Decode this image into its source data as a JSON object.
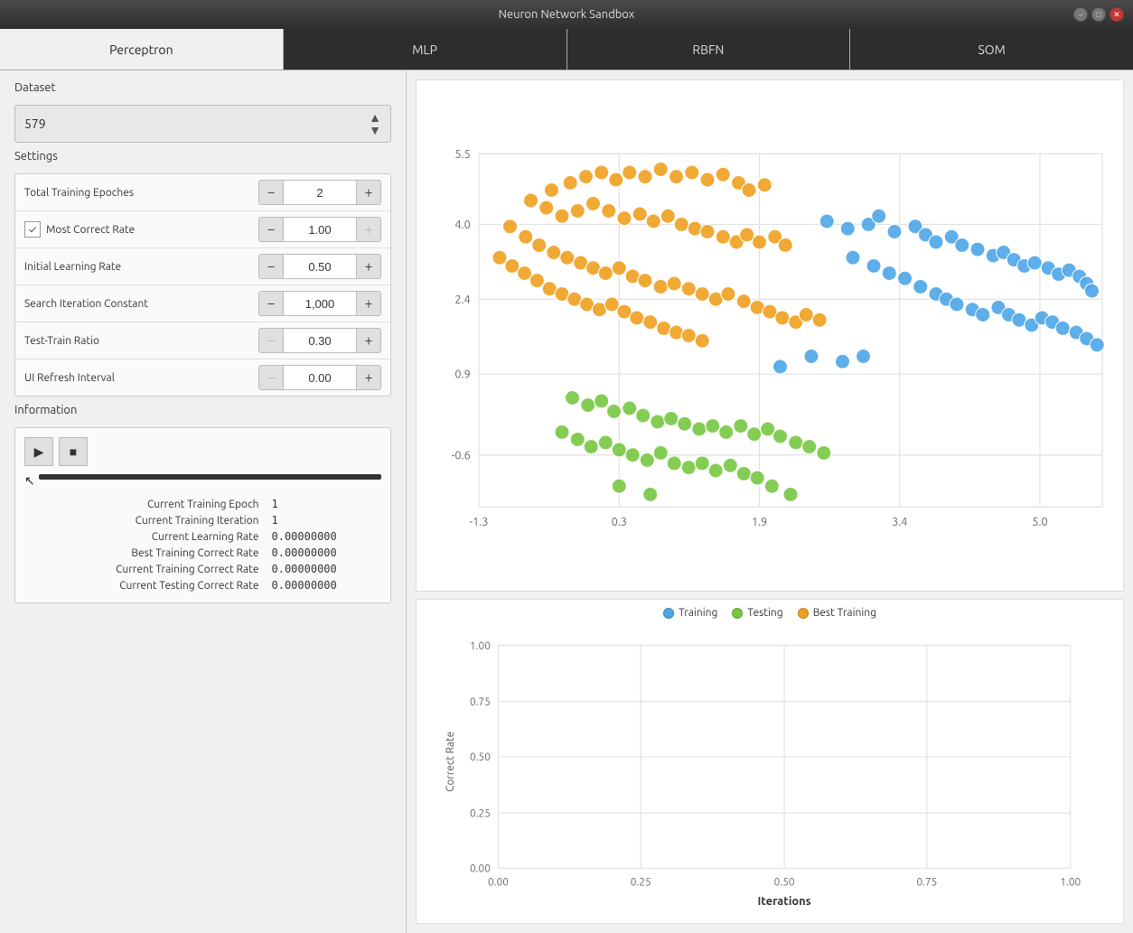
{
  "titleBar": {
    "title": "Neuron Network Sandbox"
  },
  "tabs": [
    {
      "id": "perceptron",
      "label": "Perceptron",
      "active": true
    },
    {
      "id": "mlp",
      "label": "MLP",
      "active": false
    },
    {
      "id": "rbfn",
      "label": "RBFN",
      "active": false
    },
    {
      "id": "som",
      "label": "SOM",
      "active": false
    }
  ],
  "dataset": {
    "label": "Dataset",
    "value": "579"
  },
  "settings": {
    "label": "Settings",
    "rows": [
      {
        "name": "Total Training Epoches",
        "value": "2",
        "minusDisabled": false,
        "plusDisabled": false,
        "hasCheckbox": false
      },
      {
        "name": "Most Correct Rate",
        "value": "1.00",
        "minusDisabled": false,
        "plusDisabled": true,
        "hasCheckbox": true,
        "checked": true
      },
      {
        "name": "Initial Learning Rate",
        "value": "0.50",
        "minusDisabled": false,
        "plusDisabled": false,
        "hasCheckbox": false
      },
      {
        "name": "Search Iteration Constant",
        "value": "1,000",
        "minusDisabled": false,
        "plusDisabled": false,
        "hasCheckbox": false
      },
      {
        "name": "Test-Train Ratio",
        "value": "0.30",
        "minusDisabled": true,
        "plusDisabled": false,
        "hasCheckbox": false
      },
      {
        "name": "UI Refresh Interval",
        "value": "0.00",
        "minusDisabled": true,
        "plusDisabled": false,
        "hasCheckbox": false
      }
    ]
  },
  "information": {
    "label": "Information",
    "stats": [
      {
        "label": "Current Training Epoch",
        "value": "1"
      },
      {
        "label": "Current Training Iteration",
        "value": "1"
      },
      {
        "label": "Current Learning Rate",
        "value": "0.00000000"
      },
      {
        "label": "Best Training Correct Rate",
        "value": "0.00000000"
      },
      {
        "label": "Current Training Correct Rate",
        "value": "0.00000000"
      },
      {
        "label": "Current Testing Correct Rate",
        "value": "0.00000000"
      }
    ]
  },
  "scatterChart": {
    "yAxisLabels": [
      "5.5",
      "4.0",
      "2.4",
      "0.9",
      "-0.6"
    ],
    "xAxisLabels": [
      "-1.3",
      "0.3",
      "1.9",
      "3.4",
      "5.0"
    ]
  },
  "lineChart": {
    "legend": [
      {
        "label": "Training",
        "color": "#4da6e8"
      },
      {
        "label": "Testing",
        "color": "#77c843"
      },
      {
        "label": "Best Training",
        "color": "#f0a020"
      }
    ],
    "yAxisLabel": "Correct Rate",
    "xAxisLabel": "Iterations",
    "yAxisTicks": [
      "1.00",
      "0.75",
      "0.50",
      "0.25",
      "0.00"
    ],
    "xAxisTicks": [
      "0.00",
      "0.25",
      "0.50",
      "0.75",
      "1.00"
    ]
  },
  "icons": {
    "play": "▶",
    "stop": "■",
    "cursor": "↖",
    "checkmark": "✓",
    "minus": "−",
    "plus": "+"
  }
}
